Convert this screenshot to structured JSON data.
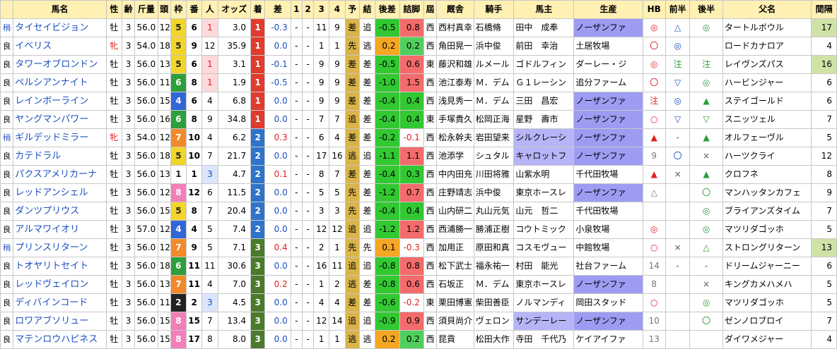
{
  "headers": [
    "馬名",
    "性",
    "齢",
    "斤量",
    "頭",
    "枠",
    "番",
    "人",
    "オッズ",
    "着",
    "差",
    "1",
    "2",
    "3",
    "4",
    "予",
    "結",
    "後差",
    "詰脚",
    "屆",
    "厩舎",
    "騎手",
    "馬主",
    "生産",
    "HB",
    "前半",
    "後半",
    "父名",
    "間隔"
  ],
  "colors": {
    "header_bg": "#fff0b3",
    "name_blue": "#1a4fc0",
    "mare_red": "#e02020",
    "track_heavy_blue": "#2050c0",
    "finish_1": "#e23a2e",
    "finish_2": "#2f74c9",
    "finish_3": "#4a7a2c",
    "plus_red": "#e02020",
    "minus_blue": "#1a4fc0",
    "yoso_bg": "#d9b44a",
    "popular_bg": "#ffd9dc",
    "popular3_bg": "#dbe6fb",
    "last3_green": "#32c832",
    "last3_orange": "#f5a623",
    "tsume_red": "#f36b6b",
    "tsume_pink": "#fba5a8",
    "tsume_green": "#4fcf5c",
    "owner_highlight": "#b7b5f7",
    "breeder_highlight": "#9c9df2",
    "interval_highlight": "#cfe3a7",
    "wakuban": [
      "#ffffff",
      "#ffffff",
      "#222222",
      "#e33d3d",
      "#2f66d8",
      "#f2d52a",
      "#2f9e3c",
      "#f28a2a",
      "#f27fb9"
    ]
  },
  "rows": [
    {
      "track": "稍",
      "name": "タイセイビジョン",
      "sex": "牡",
      "age": "3",
      "wt": "56.0",
      "field": "12",
      "waku": "5",
      "num": "6",
      "pop": "1",
      "odds": "3.0",
      "fin": "1",
      "diff": "-0.3",
      "c1": "-",
      "c2": "-",
      "c3": "11",
      "c4": "9",
      "yoso": "差",
      "result": "追",
      "l3diff": "-0.5",
      "tsume": "0.8",
      "region": "西",
      "trainer": "西村真幸",
      "jockey": "石橋脩",
      "owner": "田中　成奉",
      "breeder": "ノーザンファ",
      "hb": "◎",
      "zh": "△",
      "kh": "◎",
      "sire": "タートルボウル",
      "intv": "17"
    },
    {
      "track": "良",
      "name": "イベリス",
      "sex": "牝",
      "age": "3",
      "wt": "54.0",
      "field": "18",
      "waku": "5",
      "num": "9",
      "pop": "12",
      "odds": "35.9",
      "fin": "1",
      "diff": "0.0",
      "c1": "-",
      "c2": "-",
      "c3": "1",
      "c4": "1",
      "yoso": "先",
      "result": "逃",
      "l3diff": "0.2",
      "tsume": "0.2",
      "region": "西",
      "trainer": "角田晃一",
      "jockey": "浜中俊",
      "owner": "前田　幸治",
      "breeder": "土居牧場",
      "hb": "〇",
      "zh": "◎",
      "kh": "",
      "sire": "ロードカナロア",
      "intv": "4"
    },
    {
      "track": "良",
      "name": "タワーオブロンドン",
      "sex": "牡",
      "age": "3",
      "wt": "56.0",
      "field": "13",
      "waku": "5",
      "num": "6",
      "pop": "1",
      "odds": "3.1",
      "fin": "1",
      "diff": "-0.1",
      "c1": "-",
      "c2": "-",
      "c3": "9",
      "c4": "9",
      "yoso": "差",
      "result": "差",
      "l3diff": "-0.5",
      "tsume": "0.6",
      "region": "東",
      "trainer": "藤沢和雄",
      "jockey": "ルメール",
      "owner": "ゴドルフィン",
      "breeder": "ダーレー・ジ",
      "hb": "◎",
      "zh": "注",
      "kh": "注",
      "sire": "レイヴンズパス",
      "intv": "16"
    },
    {
      "track": "良",
      "name": "ペルシアンナイト",
      "sex": "牡",
      "age": "3",
      "wt": "56.0",
      "field": "11",
      "waku": "6",
      "num": "8",
      "pop": "1",
      "odds": "1.9",
      "fin": "1",
      "diff": "-0.5",
      "c1": "-",
      "c2": "-",
      "c3": "9",
      "c4": "9",
      "yoso": "差",
      "result": "差",
      "l3diff": "-1.0",
      "tsume": "1.5",
      "region": "西",
      "trainer": "池江泰寿",
      "jockey": "Ｍ．デム",
      "owner": "Ｇ１レーシン",
      "breeder": "追分ファーム",
      "hb": "〇",
      "zh": "▽",
      "kh": "◎",
      "sire": "ハービンジャー",
      "intv": "6"
    },
    {
      "track": "良",
      "name": "レインボーライン",
      "sex": "牡",
      "age": "3",
      "wt": "56.0",
      "field": "15",
      "waku": "4",
      "num": "6",
      "pop": "4",
      "odds": "6.8",
      "fin": "1",
      "diff": "0.0",
      "c1": "-",
      "c2": "-",
      "c3": "9",
      "c4": "9",
      "yoso": "差",
      "result": "差",
      "l3diff": "-0.4",
      "tsume": "0.4",
      "region": "西",
      "trainer": "浅見秀一",
      "jockey": "Ｍ．デム",
      "owner": "三田　昌宏",
      "breeder": "ノーザンファ",
      "hb": "注",
      "zh": "◎",
      "kh": "▲",
      "sire": "ステイゴールド",
      "intv": "6"
    },
    {
      "track": "良",
      "name": "ヤングマンパワー",
      "sex": "牡",
      "age": "3",
      "wt": "56.0",
      "field": "16",
      "waku": "6",
      "num": "8",
      "pop": "9",
      "odds": "34.8",
      "fin": "1",
      "diff": "0.0",
      "c1": "-",
      "c2": "-",
      "c3": "7",
      "c4": "7",
      "yoso": "追",
      "result": "差",
      "l3diff": "-0.4",
      "tsume": "0.4",
      "region": "東",
      "trainer": "手塚貴久",
      "jockey": "松岡正海",
      "owner": "星野　壽市",
      "breeder": "ノーザンファ",
      "hb": "○",
      "zh": "▽",
      "kh": "▽",
      "sire": "スニッツェル",
      "intv": "7"
    },
    {
      "track": "稍",
      "name": "ギルデッドミラー",
      "sex": "牝",
      "age": "3",
      "wt": "54.0",
      "field": "12",
      "waku": "7",
      "num": "10",
      "pop": "4",
      "odds": "6.2",
      "fin": "2",
      "diff": "0.3",
      "c1": "-",
      "c2": "-",
      "c3": "6",
      "c4": "4",
      "yoso": "差",
      "result": "差",
      "l3diff": "-0.2",
      "tsume": "-0.1",
      "region": "西",
      "trainer": "松永幹夫",
      "jockey": "岩田望来",
      "owner": "シルクレーシ",
      "breeder": "ノーザンファ",
      "hb": "▲",
      "zh": "-",
      "kh": "▲",
      "sire": "オルフェーヴル",
      "intv": "5"
    },
    {
      "track": "良",
      "name": "カテドラル",
      "sex": "牡",
      "age": "3",
      "wt": "56.0",
      "field": "18",
      "waku": "5",
      "num": "10",
      "pop": "7",
      "odds": "21.7",
      "fin": "2",
      "diff": "0.0",
      "c1": "-",
      "c2": "-",
      "c3": "17",
      "c4": "16",
      "yoso": "逃",
      "result": "追",
      "l3diff": "-1.1",
      "tsume": "1.1",
      "region": "西",
      "trainer": "池添学",
      "jockey": "シュタル",
      "owner": "キャロットフ",
      "breeder": "ノーザンファ",
      "hb": "9",
      "zh": "〇",
      "kh": "×",
      "sire": "ハーツクライ",
      "intv": "12"
    },
    {
      "track": "良",
      "name": "パクスアメリカーナ",
      "sex": "牡",
      "age": "3",
      "wt": "56.0",
      "field": "13",
      "waku": "1",
      "num": "1",
      "pop": "3",
      "odds": "4.7",
      "fin": "2",
      "diff": "0.1",
      "c1": "-",
      "c2": "-",
      "c3": "8",
      "c4": "7",
      "yoso": "差",
      "result": "差",
      "l3diff": "-0.4",
      "tsume": "0.3",
      "region": "西",
      "trainer": "中内田充",
      "jockey": "川田将雅",
      "owner": "山紫水明",
      "breeder": "千代田牧場",
      "hb": "▲",
      "zh": "×",
      "kh": "▲",
      "sire": "クロフネ",
      "intv": "8"
    },
    {
      "track": "良",
      "name": "レッドアンシェル",
      "sex": "牡",
      "age": "3",
      "wt": "56.0",
      "field": "12",
      "waku": "8",
      "num": "12",
      "pop": "6",
      "odds": "11.5",
      "fin": "2",
      "diff": "0.0",
      "c1": "-",
      "c2": "-",
      "c3": "5",
      "c4": "5",
      "yoso": "先",
      "result": "差",
      "l3diff": "-1.2",
      "tsume": "0.7",
      "region": "西",
      "trainer": "庄野靖志",
      "jockey": "浜中俊",
      "owner": "東京ホースレ",
      "breeder": "ノーザンファ",
      "hb": "△",
      "zh": "",
      "kh": "〇",
      "sire": "マンハッタンカフェ",
      "intv": "9"
    },
    {
      "track": "良",
      "name": "ダンツプリウス",
      "sex": "牡",
      "age": "3",
      "wt": "56.0",
      "field": "15",
      "waku": "5",
      "num": "8",
      "pop": "7",
      "odds": "20.4",
      "fin": "2",
      "diff": "0.0",
      "c1": "-",
      "c2": "-",
      "c3": "3",
      "c4": "3",
      "yoso": "先",
      "result": "差",
      "l3diff": "-0.4",
      "tsume": "0.4",
      "region": "西",
      "trainer": "山内研二",
      "jockey": "丸山元気",
      "owner": "山元　哲二",
      "breeder": "千代田牧場",
      "hb": "",
      "zh": "",
      "kh": "◎",
      "sire": "ブライアンズタイム",
      "intv": "7"
    },
    {
      "track": "良",
      "name": "アルマワイオリ",
      "sex": "牡",
      "age": "3",
      "wt": "57.0",
      "field": "12",
      "waku": "4",
      "num": "4",
      "pop": "5",
      "odds": "7.4",
      "fin": "2",
      "diff": "0.0",
      "c1": "-",
      "c2": "-",
      "c3": "12",
      "c4": "12",
      "yoso": "追",
      "result": "追",
      "l3diff": "-1.2",
      "tsume": "1.2",
      "region": "西",
      "trainer": "西浦勝一",
      "jockey": "勝浦正樹",
      "owner": "コウトミック",
      "breeder": "小泉牧場",
      "hb": "◎",
      "zh": "",
      "kh": "◎",
      "sire": "マツリダゴッホ",
      "intv": "5"
    },
    {
      "track": "稍",
      "name": "プリンスリターン",
      "sex": "牡",
      "age": "3",
      "wt": "56.0",
      "field": "12",
      "waku": "7",
      "num": "9",
      "pop": "5",
      "odds": "7.1",
      "fin": "3",
      "diff": "0.4",
      "c1": "-",
      "c2": "-",
      "c3": "2",
      "c4": "1",
      "yoso": "先",
      "result": "先",
      "l3diff": "0.1",
      "tsume": "-0.3",
      "region": "西",
      "trainer": "加用正",
      "jockey": "原田和真",
      "owner": "コスモヴュー",
      "breeder": "中館牧場",
      "hb": "○",
      "zh": "×",
      "kh": "△",
      "sire": "ストロングリターン",
      "intv": "13"
    },
    {
      "track": "良",
      "name": "トオヤリトセイト",
      "sex": "牡",
      "age": "3",
      "wt": "56.0",
      "field": "18",
      "waku": "6",
      "num": "11",
      "pop": "11",
      "odds": "30.6",
      "fin": "3",
      "diff": "0.0",
      "c1": "-",
      "c2": "-",
      "c3": "16",
      "c4": "11",
      "yoso": "追",
      "result": "追",
      "l3diff": "-0.8",
      "tsume": "0.8",
      "region": "西",
      "trainer": "松下武士",
      "jockey": "福永祐一",
      "owner": "村田　能光",
      "breeder": "社台ファーム",
      "hb": "14",
      "zh": "-",
      "kh": "-",
      "sire": "ドリームジャーニー",
      "intv": "6"
    },
    {
      "track": "良",
      "name": "レッドヴェイロン",
      "sex": "牡",
      "age": "3",
      "wt": "56.0",
      "field": "13",
      "waku": "7",
      "num": "11",
      "pop": "4",
      "odds": "7.0",
      "fin": "3",
      "diff": "0.2",
      "c1": "-",
      "c2": "-",
      "c3": "1",
      "c4": "2",
      "yoso": "逃",
      "result": "差",
      "l3diff": "-0.8",
      "tsume": "0.6",
      "region": "西",
      "trainer": "石坂正",
      "jockey": "Ｍ．デム",
      "owner": "東京ホースレ",
      "breeder": "ノーザンファ",
      "hb": "8",
      "zh": "",
      "kh": "×",
      "sire": "キングカメハメハ",
      "intv": "5"
    },
    {
      "track": "良",
      "name": "ディバインコード",
      "sex": "牡",
      "age": "3",
      "wt": "56.0",
      "field": "11",
      "waku": "2",
      "num": "2",
      "pop": "3",
      "odds": "4.5",
      "fin": "3",
      "diff": "0.0",
      "c1": "-",
      "c2": "-",
      "c3": "4",
      "c4": "4",
      "yoso": "差",
      "result": "差",
      "l3diff": "-0.6",
      "tsume": "-0.2",
      "region": "東",
      "trainer": "栗田博憲",
      "jockey": "柴田善臣",
      "owner": "ノルマンディ",
      "breeder": "岡田スタッド",
      "hb": "○",
      "zh": "",
      "kh": "◎",
      "sire": "マツリダゴッホ",
      "intv": "5"
    },
    {
      "track": "良",
      "name": "ロワアブソリュー",
      "sex": "牡",
      "age": "3",
      "wt": "56.0",
      "field": "15",
      "waku": "8",
      "num": "15",
      "pop": "7",
      "odds": "13.4",
      "fin": "3",
      "diff": "0.0",
      "c1": "-",
      "c2": "-",
      "c3": "12",
      "c4": "14",
      "yoso": "追",
      "result": "追",
      "l3diff": "-0.9",
      "tsume": "0.9",
      "region": "西",
      "trainer": "須貝尚介",
      "jockey": "ヴェロン",
      "owner": "サンデーレー",
      "breeder": "ノーザンファ",
      "hb": "10",
      "zh": "",
      "kh": "〇",
      "sire": "ゼンノロブロイ",
      "intv": "7"
    },
    {
      "track": "良",
      "name": "マテンロウハピネス",
      "sex": "牡",
      "age": "3",
      "wt": "56.0",
      "field": "15",
      "waku": "8",
      "num": "17",
      "pop": "8",
      "odds": "8.0",
      "fin": "3",
      "diff": "0.0",
      "c1": "-",
      "c2": "-",
      "c3": "1",
      "c4": "1",
      "yoso": "逃",
      "result": "逃",
      "l3diff": "0.2",
      "tsume": "0.2",
      "region": "西",
      "trainer": "昆貢",
      "jockey": "松田大作",
      "owner": "寺田　千代乃",
      "breeder": "ケイアイファ",
      "hb": "13",
      "zh": "",
      "kh": "",
      "sire": "ダイワメジャー",
      "intv": "4"
    }
  ]
}
